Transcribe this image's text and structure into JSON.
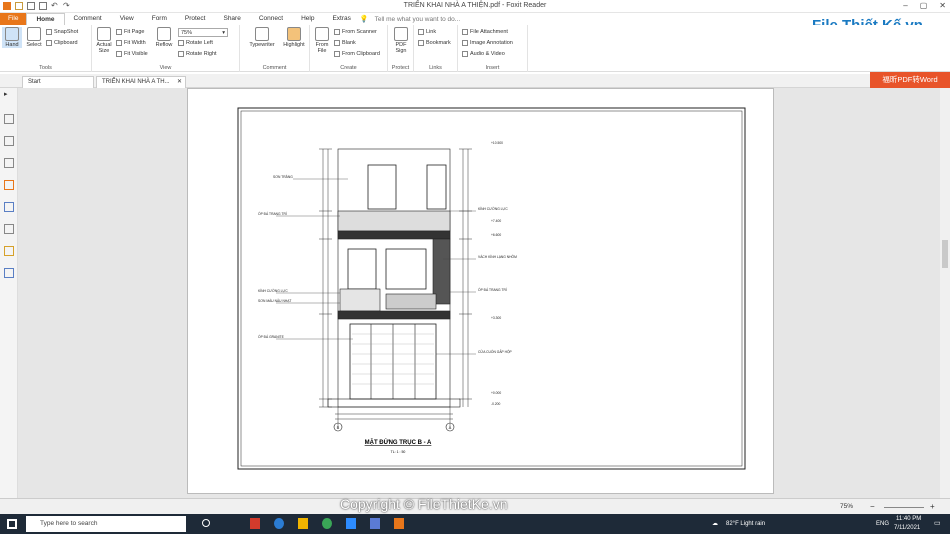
{
  "window": {
    "title": "TRIỂN KHAI NHÀ A THIỆN.pdf - Foxit Reader"
  },
  "menu": {
    "file": "File",
    "home": "Home",
    "comment": "Comment",
    "view": "View",
    "form": "Form",
    "protect": "Protect",
    "share": "Share",
    "connect": "Connect",
    "help": "Help",
    "extras": "Extras",
    "tellme": "Tell me what you want to do..."
  },
  "ribbon": {
    "tools": {
      "label": "Tools",
      "hand": "Hand",
      "select": "Select",
      "snapshot": "SnapShot",
      "clipboard": "Clipboard"
    },
    "view": {
      "label": "View",
      "actual": "Actual Size",
      "fitpage": "Fit Page",
      "fitwidth": "Fit Width",
      "fitvisible": "Fit Visible",
      "reflow": "Reflow",
      "zoom": "75%",
      "rotleft": "Rotate Left",
      "rotright": "Rotate Right"
    },
    "comment": {
      "label": "Comment",
      "typewriter": "Typewriter",
      "highlight": "Highlight"
    },
    "create": {
      "label": "Create",
      "fromfile": "From File",
      "scanner": "From Scanner",
      "blank": "Blank",
      "clipboard": "From Clipboard"
    },
    "protect": {
      "label": "Protect",
      "sign": "PDF Sign"
    },
    "links": {
      "label": "Links",
      "link": "Link",
      "bookmark": "Bookmark"
    },
    "insert": {
      "label": "Insert",
      "attach": "File Attachment",
      "image": "Image Annotation",
      "audio": "Audio & Video"
    }
  },
  "logo": {
    "text": "File Thiết Kế.vn"
  },
  "tabs": {
    "start": "Start",
    "doc": "TRIỂN KHAI NHÀ A TH..."
  },
  "wordbtn": "福昕PDF转Word",
  "drawing": {
    "title": "MẶT ĐỨNG TRỤC B - A",
    "scale": "TL: 1 : 50",
    "notes_left": [
      "SƠN TRẮNG",
      "ỐP ĐÁ TRANG TRÍ",
      "KÍNH CƯỜNG LỰC",
      "SƠN MÀU NÂU NHẠT",
      "ỐP ĐÁ GRANITE"
    ],
    "notes_right": [
      "KÍNH CƯỜNG LỰC",
      "VÁCH KÍNH LẠNG NHÔM",
      "ỐP ĐÁ TRANG TRÍ",
      "CỬA CUỐN GẤP HỘP"
    ],
    "levels": [
      "+10.500",
      "+7.400",
      "+6.600",
      "+3.300",
      "+0.000",
      "-0.200"
    ],
    "axes": [
      "B",
      "A"
    ]
  },
  "status": {
    "zoom": "75%"
  },
  "taskbar": {
    "search": "Type here to search",
    "weather": "82°F  Light rain",
    "lang": "ENG",
    "time": "11:40 PM",
    "date": "7/11/2021"
  },
  "watermark": "Copyright © FileThietKe.vn"
}
